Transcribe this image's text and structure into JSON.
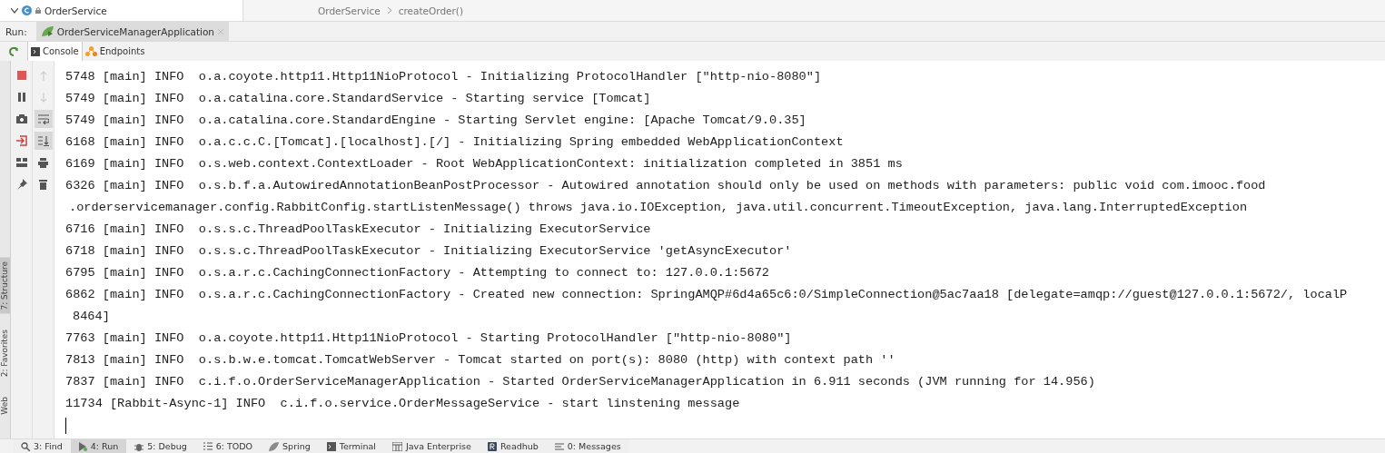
{
  "project_tree": {
    "item": "OrderService",
    "expanded": true
  },
  "breadcrumb": [
    "OrderService",
    "createOrder()"
  ],
  "run_bar": {
    "label": "Run:",
    "tabs": [
      {
        "label": "OrderServiceManagerApplication",
        "selected": true
      }
    ]
  },
  "console_tabs": [
    {
      "label": "Console",
      "selected": true
    },
    {
      "label": "Endpoints",
      "selected": false
    }
  ],
  "toolbar": [
    {
      "kind": "rerun"
    },
    {
      "kind": "stop"
    },
    {
      "kind": "pause"
    },
    {
      "kind": "camera"
    },
    {
      "kind": "exit"
    },
    {
      "kind": "layout"
    },
    {
      "kind": "pin"
    }
  ],
  "console_toolbar": [
    {
      "kind": "up",
      "disabled": true,
      "selected": false
    },
    {
      "kind": "down",
      "disabled": true,
      "selected": false
    },
    {
      "kind": "wrap",
      "disabled": false,
      "selected": true
    },
    {
      "kind": "scroll-end",
      "disabled": false,
      "selected": true
    },
    {
      "kind": "print",
      "disabled": false,
      "selected": false
    },
    {
      "kind": "trash",
      "disabled": false,
      "selected": false
    }
  ],
  "side_tools": [
    {
      "label": "7: Structure",
      "selected": true
    },
    {
      "label": "2: Favorites",
      "selected": false
    },
    {
      "label": "Web",
      "selected": false
    }
  ],
  "console": {
    "lines": [
      {
        "kind": "entry",
        "text": "5748 [main] INFO  o.a.coyote.http11.Http11NioProtocol - Initializing ProtocolHandler [\"http-nio-8080\"]"
      },
      {
        "kind": "entry",
        "text": "5749 [main] INFO  o.a.catalina.core.StandardService - Starting service [Tomcat]"
      },
      {
        "kind": "entry",
        "text": "5749 [main] INFO  o.a.catalina.core.StandardEngine - Starting Servlet engine: [Apache Tomcat/9.0.35]"
      },
      {
        "kind": "entry",
        "text": "6168 [main] INFO  o.a.c.c.C.[Tomcat].[localhost].[/] - Initializing Spring embedded WebApplicationContext"
      },
      {
        "kind": "entry",
        "text": "6169 [main] INFO  o.s.web.context.ContextLoader - Root WebApplicationContext: initialization completed in 3851 ms"
      },
      {
        "kind": "entry",
        "text": "6326 [main] INFO  o.s.b.f.a.AutowiredAnnotationBeanPostProcessor - Autowired annotation should only be used on methods with parameters: public void com.imooc.food"
      },
      {
        "kind": "continuation",
        "text": ".orderservicemanager.config.RabbitConfig.startListenMessage() throws java.io.IOException, java.util.concurrent.TimeoutException, java.lang.InterruptedException"
      },
      {
        "kind": "entry",
        "text": "6716 [main] INFO  o.s.s.c.ThreadPoolTaskExecutor - Initializing ExecutorService"
      },
      {
        "kind": "entry",
        "text": "6718 [main] INFO  o.s.s.c.ThreadPoolTaskExecutor - Initializing ExecutorService 'getAsyncExecutor'"
      },
      {
        "kind": "entry",
        "text": "6795 [main] INFO  o.s.a.r.c.CachingConnectionFactory - Attempting to connect to: 127.0.0.1:5672"
      },
      {
        "kind": "entry",
        "text": "6862 [main] INFO  o.s.a.r.c.CachingConnectionFactory - Created new connection: SpringAMQP#6d4a65c6:0/SimpleConnection@5ac7aa18 [delegate=amqp://guest@127.0.0.1:5672/, localP"
      },
      {
        "kind": "continuation",
        "text": "8464]"
      },
      {
        "kind": "entry",
        "text": "7763 [main] INFO  o.a.coyote.http11.Http11NioProtocol - Starting ProtocolHandler [\"http-nio-8080\"]"
      },
      {
        "kind": "entry",
        "text": "7813 [main] INFO  o.s.b.w.e.tomcat.TomcatWebServer - Tomcat started on port(s): 8080 (http) with context path ''"
      },
      {
        "kind": "entry",
        "text": "7837 [main] INFO  c.i.f.o.OrderServiceManagerApplication - Started OrderServiceManagerApplication in 6.911 seconds (JVM running for 14.956)"
      },
      {
        "kind": "entry",
        "text": "11734 [Rabbit-Async-1] INFO  c.i.f.o.service.OrderMessageService - start linstening message"
      }
    ]
  },
  "status_bar": [
    {
      "kind": "find",
      "label": "3: Find",
      "selected": false
    },
    {
      "kind": "run",
      "label": "4: Run",
      "selected": true
    },
    {
      "kind": "debug",
      "label": "5: Debug",
      "selected": false
    },
    {
      "kind": "todo",
      "label": "6: TODO",
      "selected": false
    },
    {
      "kind": "spring",
      "label": "Spring",
      "selected": false
    },
    {
      "kind": "terminal",
      "label": "Terminal",
      "selected": false
    },
    {
      "kind": "enterprise",
      "label": "Java Enterprise",
      "selected": false
    },
    {
      "kind": "readhub",
      "label": "Readhub",
      "selected": false
    },
    {
      "kind": "messages",
      "label": "0: Messages",
      "selected": false
    }
  ]
}
